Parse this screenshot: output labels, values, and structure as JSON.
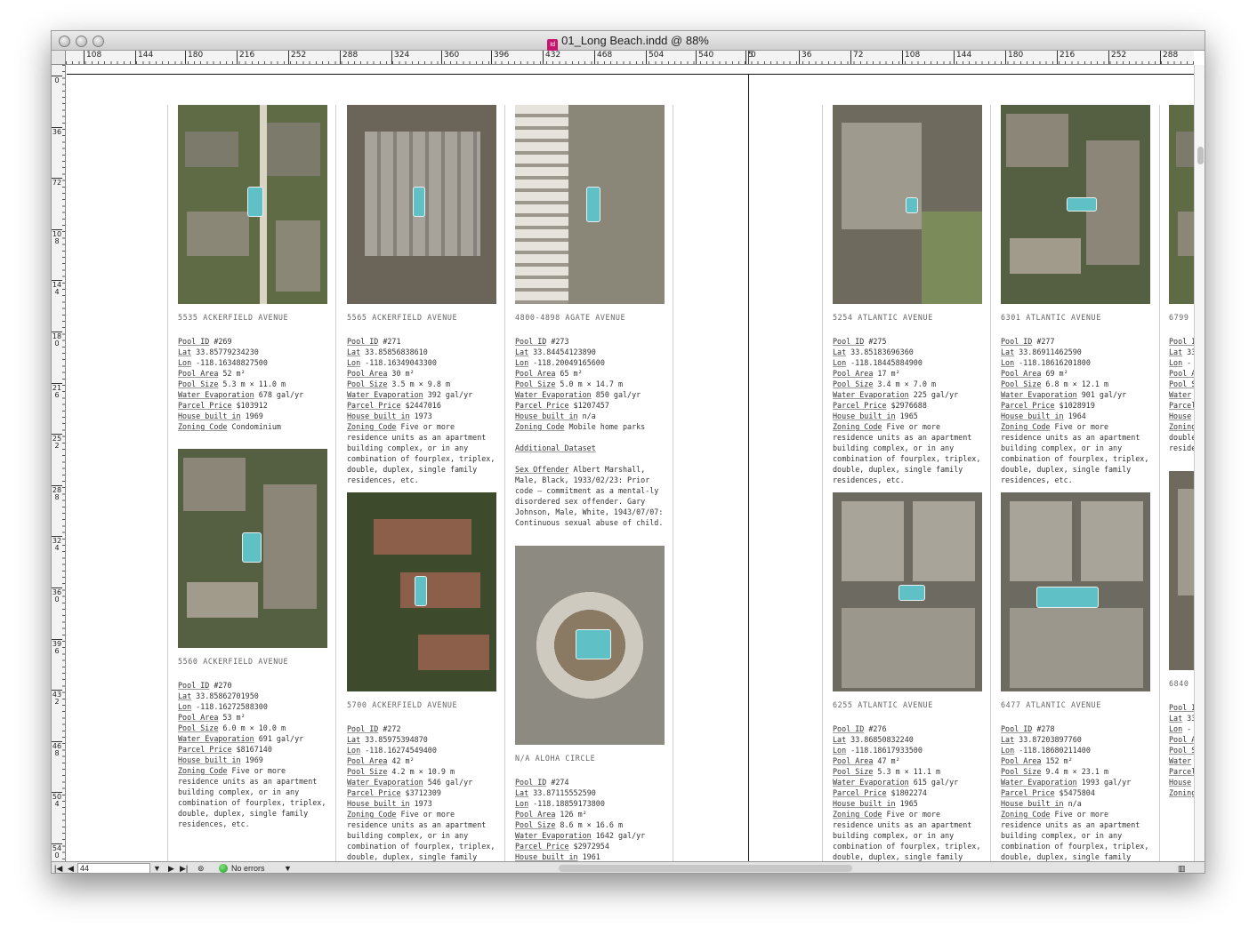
{
  "window": {
    "title": "01_Long Beach.indd @ 88%",
    "doc_icon": "Id"
  },
  "hruler": [
    "108",
    "144",
    "180",
    "216",
    "252",
    "288",
    "324",
    "360",
    "396",
    "432",
    "468",
    "504",
    "540",
    "5",
    "0",
    "36",
    "72",
    "108",
    "144",
    "180",
    "216",
    "252",
    "288"
  ],
  "vruler": [
    "0",
    "36",
    "72",
    "108",
    "144",
    "180",
    "216",
    "252",
    "288",
    "324",
    "360",
    "396",
    "432",
    "468",
    "504",
    "540"
  ],
  "cards": [
    {
      "address": "5535 ACKERFIELD AVENUE",
      "rows": [
        {
          "k": "Pool ID",
          "v": " #269"
        },
        {
          "k": "Lat",
          "v": " 33.85779234230"
        },
        {
          "k": "Lon",
          "v": " -118.16348827500"
        },
        {
          "k": "Pool Area",
          "v": " 52 m²"
        },
        {
          "k": "Pool Size",
          "v": " 5.3 m × 11.0 m"
        },
        {
          "k": "Water Evaporation",
          "v": " 678 gal/yr"
        },
        {
          "k": "Parcel Price",
          "v": " $103912"
        },
        {
          "k": "House built in",
          "v": " 1969"
        },
        {
          "k": "Zoning Code",
          "v": " Condominium"
        }
      ]
    },
    {
      "address": "5560 ACKERFIELD AVENUE",
      "rows": [
        {
          "k": "Pool ID",
          "v": " #270"
        },
        {
          "k": "Lat",
          "v": " 33.85862701950"
        },
        {
          "k": "Lon",
          "v": " -118.16272588300"
        },
        {
          "k": "Pool Area",
          "v": " 53 m²"
        },
        {
          "k": "Pool Size",
          "v": " 6.0 m × 10.0 m"
        },
        {
          "k": "Water Evaporation",
          "v": " 691 gal/yr"
        },
        {
          "k": "Parcel Price",
          "v": " $8167140"
        },
        {
          "k": "House built in",
          "v": " 1969"
        },
        {
          "k": "Zoning Code",
          "v": " Five or more residence units as an apartment building complex, or in any combination of fourplex, triplex, double, duplex, single family residences, etc."
        }
      ]
    },
    {
      "address": "5565 ACKERFIELD AVENUE",
      "rows": [
        {
          "k": "Pool ID",
          "v": " #271"
        },
        {
          "k": "Lat",
          "v": " 33.85856838610"
        },
        {
          "k": "Lon",
          "v": " -118.16349043300"
        },
        {
          "k": "Pool Area",
          "v": " 30 m²"
        },
        {
          "k": "Pool Size",
          "v": " 3.5 m × 9.8 m"
        },
        {
          "k": "Water Evaporation",
          "v": " 392 gal/yr"
        },
        {
          "k": "Parcel Price",
          "v": " $2447016"
        },
        {
          "k": "House built in",
          "v": " 1973"
        },
        {
          "k": "Zoning Code",
          "v": " Five or more residence units as an apartment building complex, or in any combination of fourplex, triplex, double, duplex, single family residences, etc."
        }
      ]
    },
    {
      "address": "5700 ACKERFIELD AVENUE",
      "rows": [
        {
          "k": "Pool ID",
          "v": " #272"
        },
        {
          "k": "Lat",
          "v": " 33.85975394870"
        },
        {
          "k": "Lon",
          "v": " -118.16274549400"
        },
        {
          "k": "Pool Area",
          "v": " 42 m²"
        },
        {
          "k": "Pool Size",
          "v": " 4.2 m × 10.9 m"
        },
        {
          "k": "Water Evaporation",
          "v": " 546 gal/yr"
        },
        {
          "k": "Parcel Price",
          "v": " $3712309"
        },
        {
          "k": "House built in",
          "v": " 1973"
        },
        {
          "k": "Zoning Code",
          "v": " Five or more residence units as an apartment building complex, or in any combination of fourplex, triplex, double, duplex, single family residences, etc."
        }
      ]
    },
    {
      "address": "4800-4898 AGATE AVENUE",
      "rows": [
        {
          "k": "Pool ID",
          "v": " #273"
        },
        {
          "k": "Lat",
          "v": " 33.84454123890"
        },
        {
          "k": "Lon",
          "v": " -118.20049165600"
        },
        {
          "k": "Pool Area",
          "v": " 65 m²"
        },
        {
          "k": "Pool Size",
          "v": " 5.0 m × 14.7 m"
        },
        {
          "k": "Water Evaporation",
          "v": " 850 gal/yr"
        },
        {
          "k": "Parcel Price",
          "v": " $1207457"
        },
        {
          "k": "House built in",
          "v": " n/a"
        },
        {
          "k": "Zoning Code",
          "v": " Mobile home parks"
        }
      ],
      "extra_heading": "Additional Dataset",
      "extra_row": {
        "k": "Sex Offender",
        "v": " Albert Marshall, Male, Black, 1933/02/23: Prior code – commitment as a mental-ly disordered sex offender. Gary Johnson, Male, White, 1943/07/07: Continuous sexual abuse of child."
      }
    },
    {
      "address": "N/A ALOHA CIRCLE",
      "rows": [
        {
          "k": "Pool ID",
          "v": " #274"
        },
        {
          "k": "Lat",
          "v": " 33.87115552590"
        },
        {
          "k": "Lon",
          "v": " -118.18859173800"
        },
        {
          "k": "Pool Area",
          "v": " 126 m²"
        },
        {
          "k": "Pool Size",
          "v": " 8.6 m × 16.6 m"
        },
        {
          "k": "Water Evaporation",
          "v": " 1642 gal/yr"
        },
        {
          "k": "Parcel Price",
          "v": " $2972954"
        },
        {
          "k": "House built in",
          "v": " 1961"
        }
      ]
    },
    {
      "address": "5254 ATLANTIC AVENUE",
      "rows": [
        {
          "k": "Pool ID",
          "v": " #275"
        },
        {
          "k": "Lat",
          "v": " 33.85183696360"
        },
        {
          "k": "Lon",
          "v": " -118.18445884900"
        },
        {
          "k": "Pool Area",
          "v": " 17 m²"
        },
        {
          "k": "Pool Size",
          "v": " 3.4 m × 7.0 m"
        },
        {
          "k": "Water Evaporation",
          "v": " 225 gal/yr"
        },
        {
          "k": "Parcel Price",
          "v": " $2976688"
        },
        {
          "k": "House built in",
          "v": " 1965"
        },
        {
          "k": "Zoning Code",
          "v": " Five or more residence units as an apartment building complex, or in any combination of fourplex, triplex, double, duplex, single family residences, etc."
        }
      ]
    },
    {
      "address": "6255 ATLANTIC AVENUE",
      "rows": [
        {
          "k": "Pool ID",
          "v": " #276"
        },
        {
          "k": "Lat",
          "v": " 33.86850832240"
        },
        {
          "k": "Lon",
          "v": " -118.18617933500"
        },
        {
          "k": "Pool Area",
          "v": " 47 m²"
        },
        {
          "k": "Pool Size",
          "v": " 5.3 m × 11.1 m"
        },
        {
          "k": "Water Evaporation",
          "v": " 615 gal/yr"
        },
        {
          "k": "Parcel Price",
          "v": " $1802274"
        },
        {
          "k": "House built in",
          "v": " 1965"
        },
        {
          "k": "Zoning Code",
          "v": " Five or more residence units as an apartment building complex, or in any combination of fourplex, triplex, double, duplex, single family residences, etc."
        }
      ]
    },
    {
      "address": "6301 ATLANTIC AVENUE",
      "rows": [
        {
          "k": "Pool ID",
          "v": " #277"
        },
        {
          "k": "Lat",
          "v": " 33.86911462590"
        },
        {
          "k": "Lon",
          "v": " -118.18616201800"
        },
        {
          "k": "Pool Area",
          "v": " 69 m²"
        },
        {
          "k": "Pool Size",
          "v": " 6.8 m × 12.1 m"
        },
        {
          "k": "Water Evaporation",
          "v": " 901 gal/yr"
        },
        {
          "k": "Parcel Price",
          "v": " $1028919"
        },
        {
          "k": "House built in",
          "v": " 1964"
        },
        {
          "k": "Zoning Code",
          "v": " Five or more residence units as an apartment building complex, or in any combination of fourplex, triplex, double, duplex, single family residences, etc."
        }
      ]
    },
    {
      "address": "6477 ATLANTIC AVENUE",
      "rows": [
        {
          "k": "Pool ID",
          "v": " #278"
        },
        {
          "k": "Lat",
          "v": " 33.87203897760"
        },
        {
          "k": "Lon",
          "v": " -118.18680211400"
        },
        {
          "k": "Pool Area",
          "v": " 152 m²"
        },
        {
          "k": "Pool Size",
          "v": " 9.4 m × 23.1 m"
        },
        {
          "k": "Water Evaporation",
          "v": " 1993 gal/yr"
        },
        {
          "k": "Parcel Price",
          "v": " $5475804"
        },
        {
          "k": "House built in",
          "v": " n/a"
        },
        {
          "k": "Zoning Code",
          "v": " Five or more residence units as an apartment building complex, or in any combination of fourplex, triplex, double, duplex, single family residences, etc."
        }
      ]
    },
    {
      "address": "6799",
      "rows": [
        {
          "k": "Pool I",
          "v": ""
        },
        {
          "k": "Lat",
          "v": " 33"
        },
        {
          "k": "Lon",
          "v": " -"
        },
        {
          "k": "Pool A",
          "v": ""
        },
        {
          "k": "Pool S",
          "v": ""
        },
        {
          "k": "Water",
          "v": ""
        },
        {
          "k": "Parcel",
          "v": ""
        },
        {
          "k": "House",
          "v": ""
        },
        {
          "k": "Zoning",
          "v": ""
        },
        {
          "k": "",
          "v": "double"
        },
        {
          "k": "",
          "v": "reside"
        }
      ]
    },
    {
      "address": "6840",
      "rows": [
        {
          "k": "Pool I",
          "v": ""
        },
        {
          "k": "Lat",
          "v": " 33"
        },
        {
          "k": "Lon",
          "v": " -"
        },
        {
          "k": "Pool A",
          "v": ""
        },
        {
          "k": "Pool S",
          "v": ""
        },
        {
          "k": "Water",
          "v": ""
        },
        {
          "k": "Parcel",
          "v": ""
        },
        {
          "k": "House",
          "v": ""
        },
        {
          "k": "Zoning",
          "v": ""
        }
      ]
    }
  ],
  "statusbar": {
    "page_number": "44",
    "preflight": "No errors"
  }
}
